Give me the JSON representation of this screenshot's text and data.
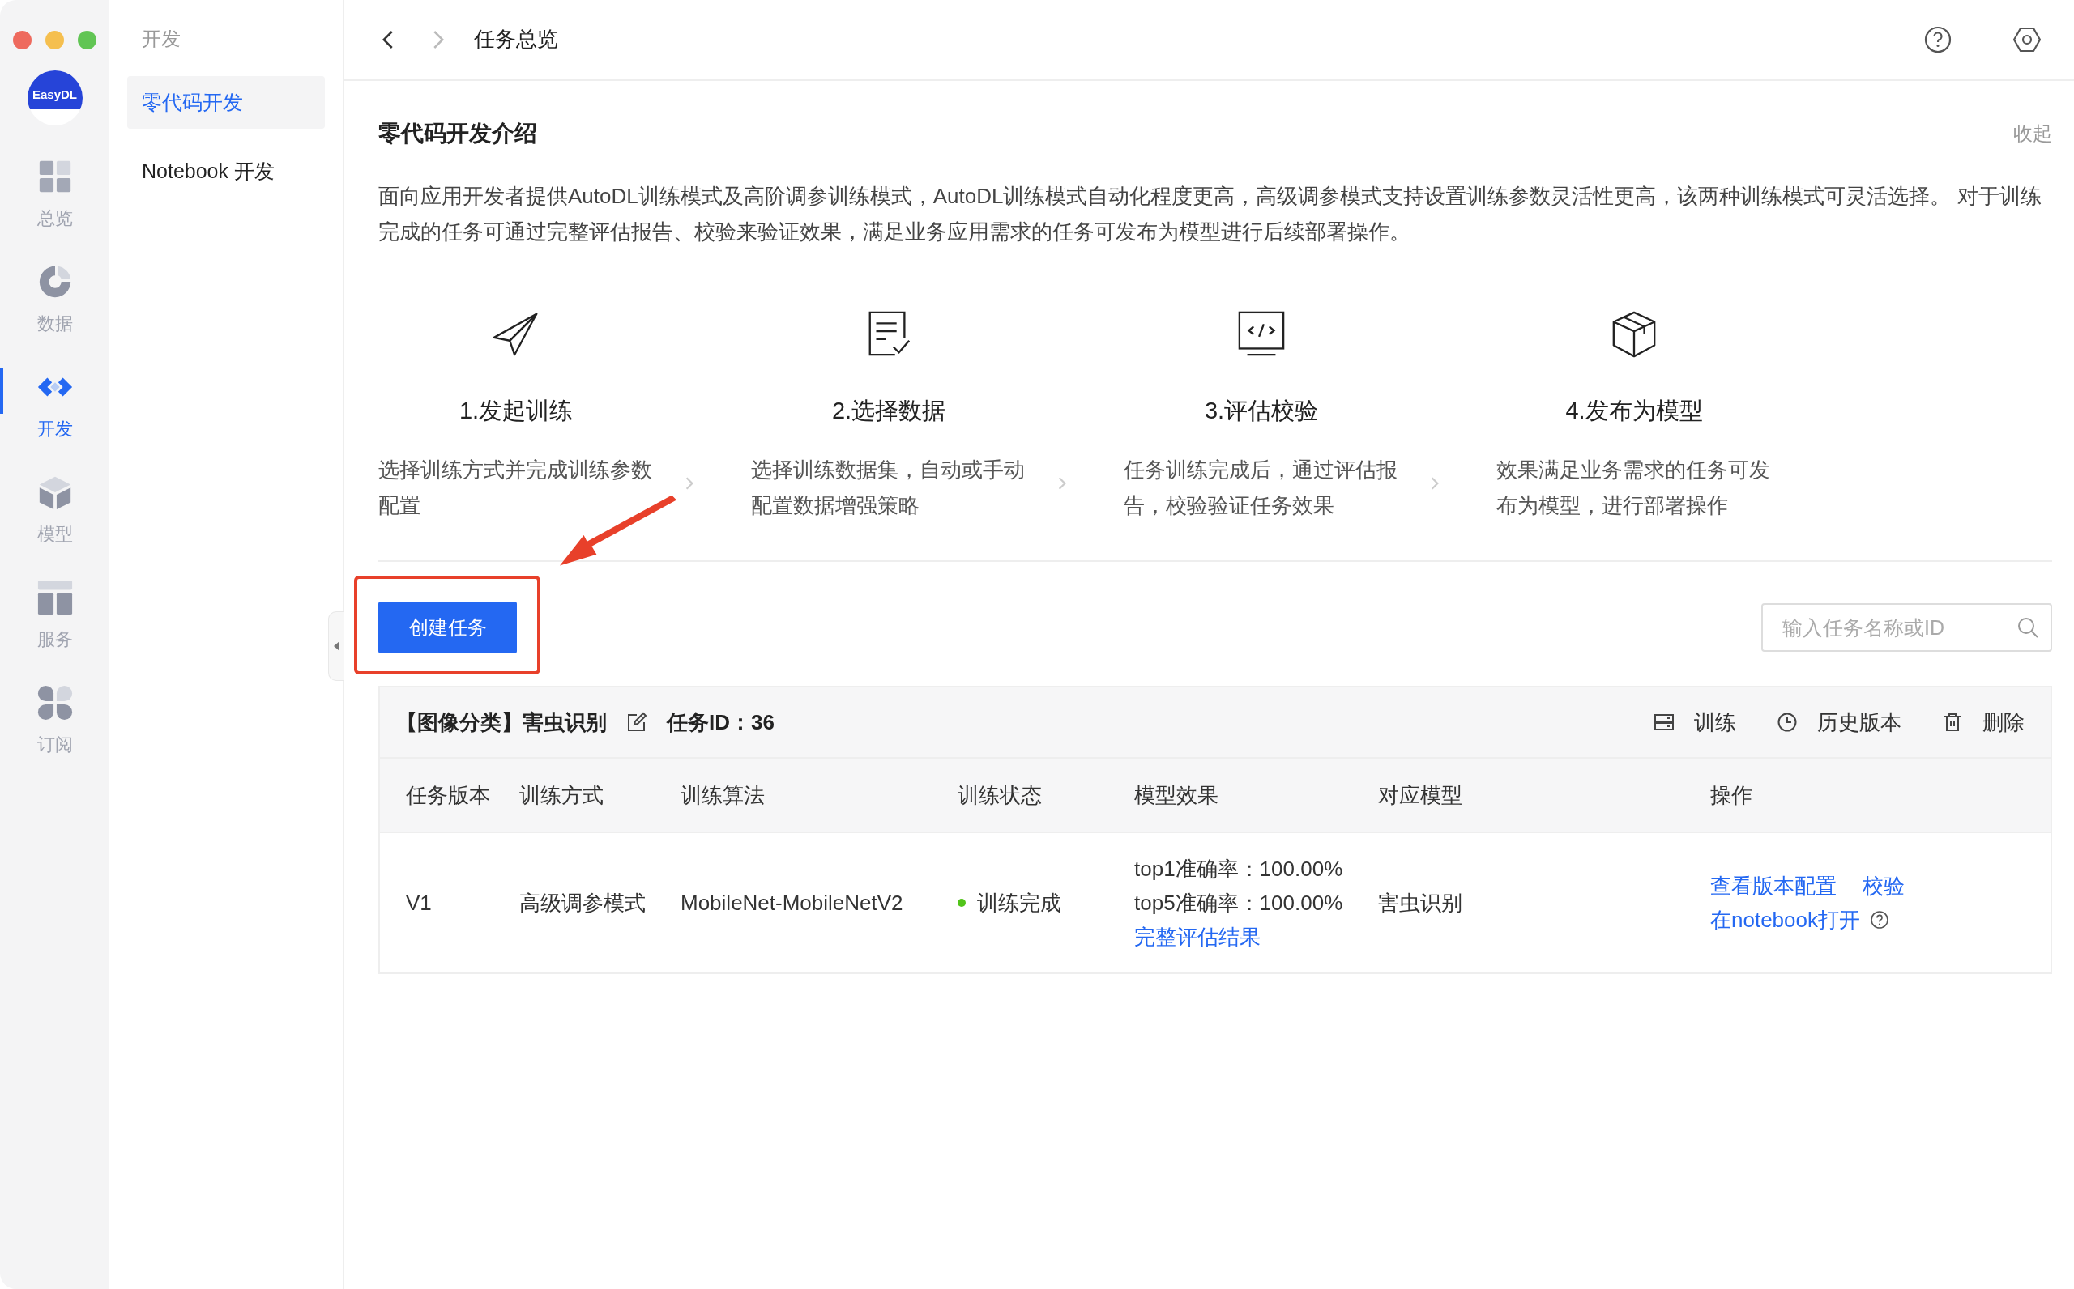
{
  "rail": {
    "logo": "EasyDL",
    "items": [
      {
        "kind": "overview",
        "label": "总览",
        "selected": false
      },
      {
        "kind": "data",
        "label": "数据",
        "selected": false
      },
      {
        "kind": "develop",
        "label": "开发",
        "selected": true
      },
      {
        "kind": "model",
        "label": "模型",
        "selected": false
      },
      {
        "kind": "service",
        "label": "服务",
        "selected": false
      },
      {
        "kind": "subscribe",
        "label": "订阅",
        "selected": false
      }
    ]
  },
  "subnav": {
    "heading": "开发",
    "items": [
      {
        "label": "零代码开发",
        "selected": true
      },
      {
        "label": "Notebook 开发",
        "selected": false
      }
    ]
  },
  "header": {
    "title": "任务总览"
  },
  "intro": {
    "title": "零代码开发介绍",
    "collapse": "收起",
    "text": "面向应用开发者提供AutoDL训练模式及高阶调参训练模式，AutoDL训练模式自动化程度更高，高级调参模式支持设置训练参数灵活性更高，该两种训练模式可灵活选择。 对于训练完成的任务可通过完整评估报告、校验来验证效果，满足业务应用需求的任务可发布为模型进行后续部署操作。",
    "steps": [
      {
        "kind": "send",
        "title": "1.发起训练",
        "desc": "选择训练方式并完成训练参数配置"
      },
      {
        "kind": "document",
        "title": "2.选择数据",
        "desc": "选择训练数据集，自动或手动配置数据增强策略"
      },
      {
        "kind": "code",
        "title": "3.评估校验",
        "desc": "任务训练完成后，通过评估报告，校验验证任务效果"
      },
      {
        "kind": "cube",
        "title": "4.发布为模型",
        "desc": "效果满足业务需求的任务可发布为模型，进行部署操作"
      }
    ]
  },
  "toolbar": {
    "create_button": "创建任务",
    "search": {
      "placeholder": "输入任务名称或ID"
    }
  },
  "task": {
    "title": "【图像分类】害虫识别",
    "id_label": "任务ID：36",
    "actions": [
      {
        "kind": "train",
        "label": "训练"
      },
      {
        "kind": "history",
        "label": "历史版本"
      },
      {
        "kind": "delete",
        "label": "删除"
      }
    ],
    "table": {
      "columns": [
        "任务版本",
        "训练方式",
        "训练算法",
        "训练状态",
        "模型效果",
        "对应模型",
        "操作"
      ],
      "rows": [
        {
          "version": "V1",
          "method": "高级调参模式",
          "algorithm": "MobileNet-MobileNetV2",
          "status": {
            "text": "训练完成",
            "color": "#52c41a"
          },
          "metrics": [
            "top1准确率：100.00%",
            "top5准确率：100.00%"
          ],
          "metrics_link": "完整评估结果",
          "model": "害虫识别",
          "ops": [
            "查看版本配置",
            "校验",
            "在notebook打开"
          ]
        }
      ]
    }
  }
}
